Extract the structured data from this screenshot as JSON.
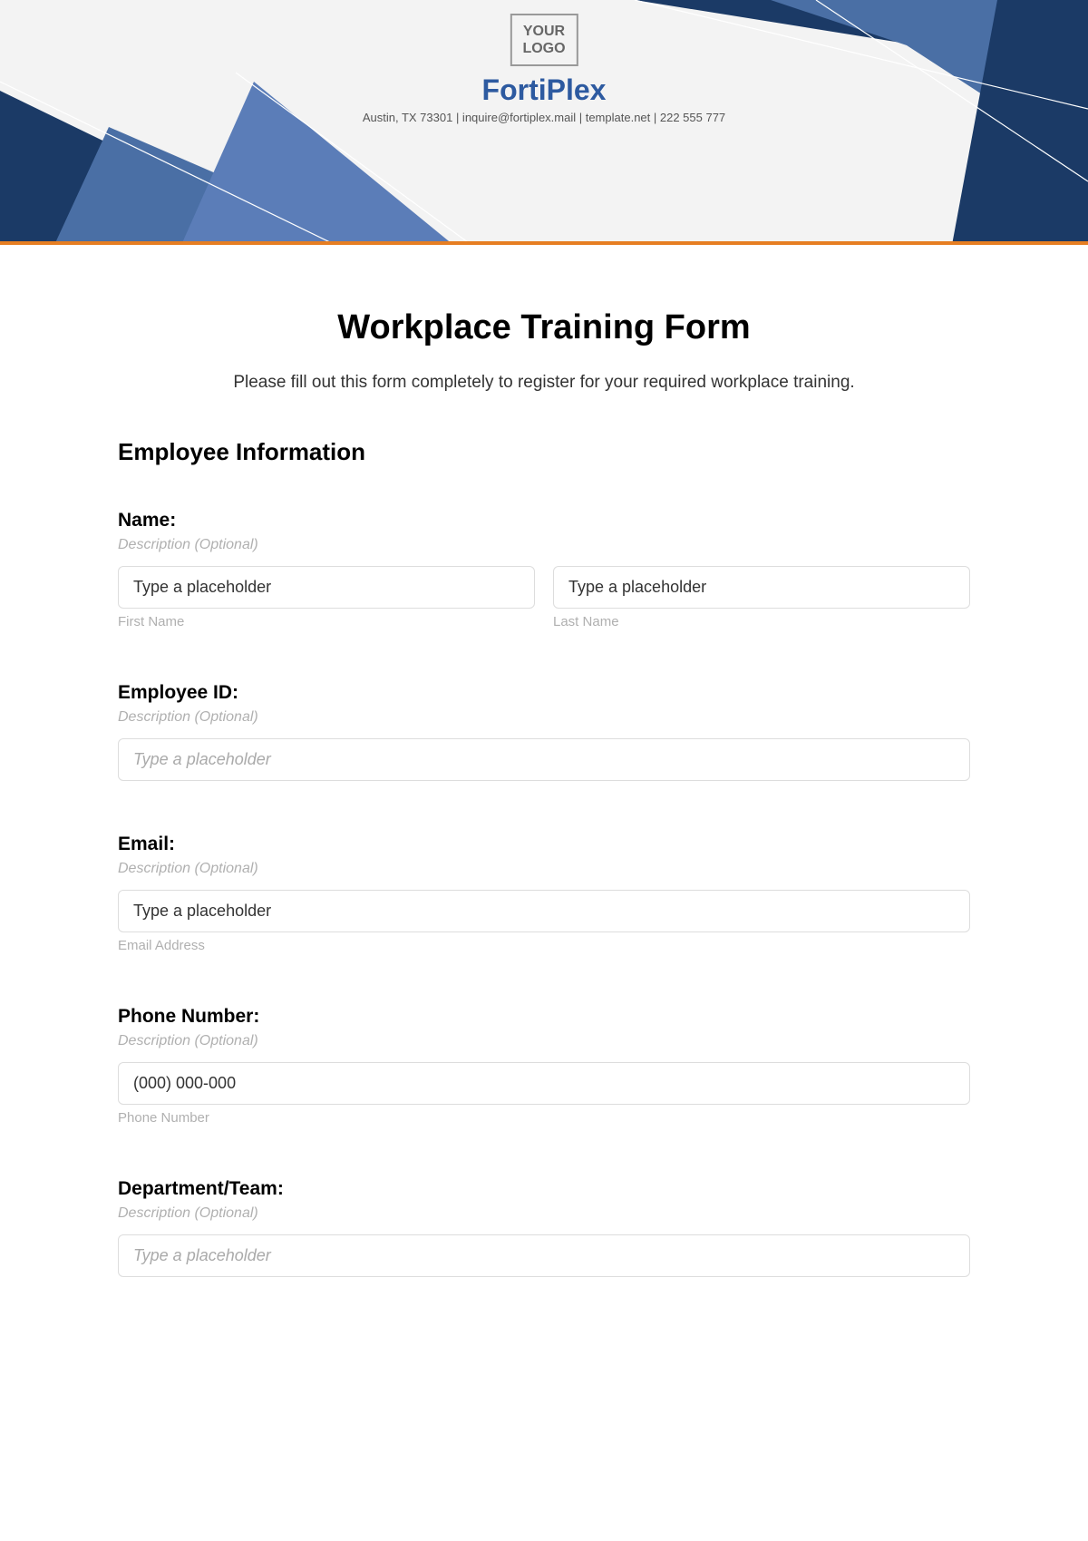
{
  "header": {
    "logo_text": "YOUR\nLOGO",
    "company_name": "FortiPlex",
    "company_info": "Austin, TX 73301 | inquire@fortiplex.mail | template.net | 222 555 777"
  },
  "form": {
    "title": "Workplace Training Form",
    "description": "Please fill out this form completely to register for your required workplace training.",
    "section_heading": "Employee Information",
    "fields": {
      "name": {
        "label": "Name:",
        "description": "Description (Optional)",
        "first_name_value": "Type a placeholder",
        "first_name_sublabel": "First Name",
        "last_name_value": "Type a placeholder",
        "last_name_sublabel": "Last Name"
      },
      "employee_id": {
        "label": "Employee ID:",
        "description": "Description (Optional)",
        "placeholder": "Type a placeholder"
      },
      "email": {
        "label": "Email:",
        "description": "Description (Optional)",
        "value": "Type a placeholder",
        "sublabel": "Email Address"
      },
      "phone": {
        "label": "Phone Number:",
        "description": "Description (Optional)",
        "value": "(000) 000-000",
        "sublabel": "Phone Number"
      },
      "department": {
        "label": "Department/Team:",
        "description": "Description (Optional)",
        "placeholder": "Type a placeholder"
      }
    }
  }
}
